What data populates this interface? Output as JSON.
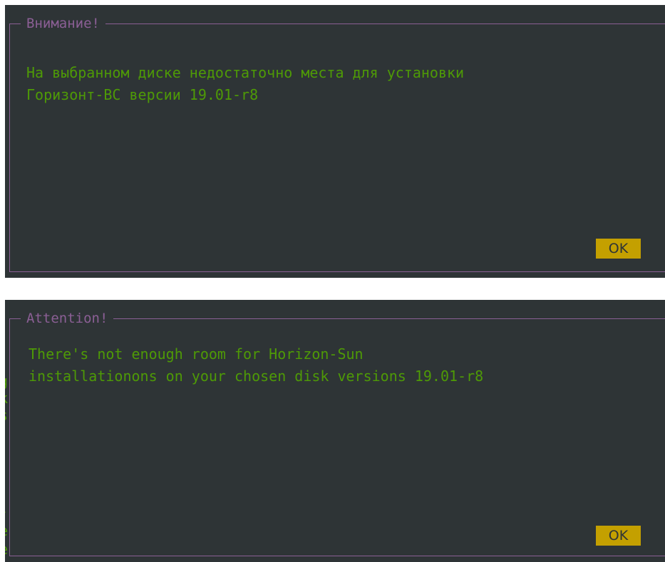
{
  "dialogs": [
    {
      "title": "Внимание!",
      "message_lines": [
        "На выбранном диске недостаточно места для установки",
        "Горизонт-ВС версии 19.01-r8"
      ],
      "ok_label": "OK"
    },
    {
      "title": "Attention!",
      "message_lines": [
        "There's not enough room for Horizon-Sun",
        "installationons on your chosen disk versions 19.01-r8"
      ],
      "ok_label": "OK"
    }
  ],
  "colors": {
    "background": "#2e3436",
    "border": "#8b5f95",
    "text": "#4e9a06",
    "button": "#c4a000",
    "button_text": "#2e3436"
  }
}
